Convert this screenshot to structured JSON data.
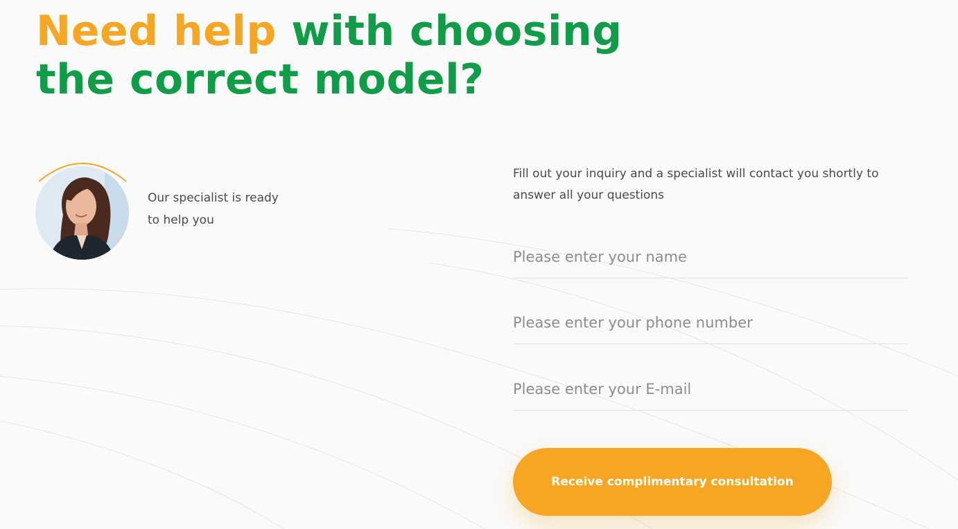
{
  "headline": {
    "accent": "Need help",
    "rest_line1": " with choosing",
    "line2": "the correct model?"
  },
  "specialist": {
    "line1": "Our specialist is ready",
    "line2": "to help you"
  },
  "form": {
    "intro": "Fill out your inquiry and a specialist will contact you shortly to answer all your questions",
    "name_placeholder": "Please enter your name",
    "phone_placeholder": "Please enter your phone number",
    "email_placeholder": "Please enter your E-mail",
    "submit_label": "Receive complimentary consultation"
  },
  "colors": {
    "accent_orange": "#f6a623",
    "brand_green": "#0f9d47",
    "background": "#fafafa"
  }
}
